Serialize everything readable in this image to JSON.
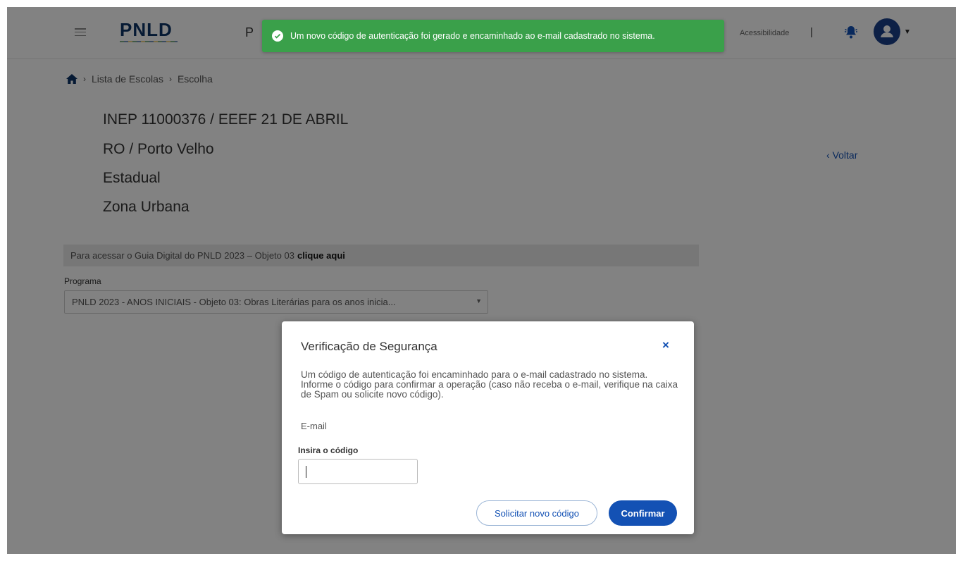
{
  "header": {
    "logo": "PNLD",
    "nav_partial": "P",
    "accessibility": "Acessibilidade",
    "separator": "|"
  },
  "toast": {
    "message": "Um novo código de autenticação foi gerado e encaminhado ao e-mail cadastrado no sistema.",
    "color": "#3aa04a"
  },
  "breadcrumb": {
    "items": [
      "Lista de Escolas",
      "Escolha"
    ],
    "separator": "›"
  },
  "school": {
    "line1": "INEP 11000376 / EEEF 21 DE ABRIL",
    "line2": "RO / Porto Velho",
    "line3": "Estadual",
    "line4": "Zona Urbana"
  },
  "voltar": "Voltar",
  "banner": {
    "text": "Para acessar o Guia Digital do PNLD 2023 – Objeto 03",
    "link": "clique aqui"
  },
  "programa": {
    "label": "Programa",
    "selected": "PNLD 2023 - ANOS INICIAIS - Objeto 03: Obras Literárias para os anos inicia..."
  },
  "modal": {
    "title": "Verificação de Segurança",
    "close": "×",
    "text": "Um código de autenticação foi encaminhado para o e-mail cadastrado no sistema. Informe o código para confirmar a operação (caso não receba o e-mail, verifique na caixa de Spam ou solicite novo código).",
    "email_label": "E-mail",
    "code_label": "Insira o código",
    "code_value": "",
    "btn_secondary": "Solicitar novo código",
    "btn_primary": "Confirmar"
  },
  "colors": {
    "primary": "#1351b4",
    "logo": "#0c3366",
    "avatar": "#1a3f8a"
  }
}
